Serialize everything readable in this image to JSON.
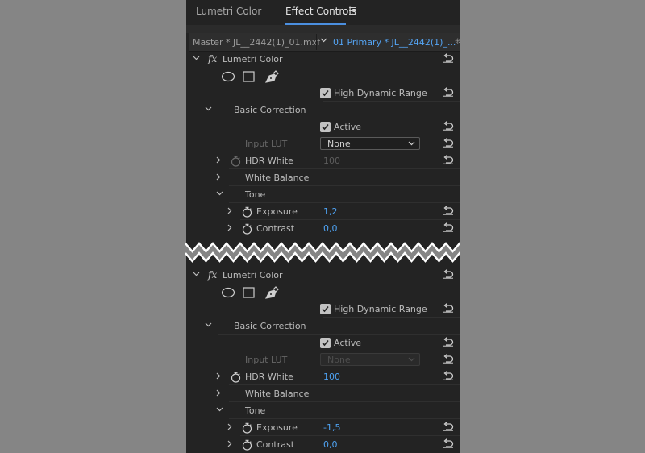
{
  "tabs": [
    {
      "label": "Lumetri Color",
      "active": false
    },
    {
      "label": "Effect Controls",
      "active": true
    }
  ],
  "clip_header": {
    "master_label": "Master * JL__2442(1)_01.mxf",
    "sequence_label": "01 Primary * JL__2442(1)_...",
    "scroll_glyph": "⁜"
  },
  "colors": {
    "panel_bg": "#232323",
    "accent_blue": "#4ea2f2",
    "text": "#bcbcbc",
    "dim_text": "#666666"
  },
  "top": {
    "effect_name": "Lumetri Color",
    "fx_glyph": "fx",
    "hdr_label": "High Dynamic Range",
    "hdr_checked": true,
    "basic_correction_label": "Basic Correction",
    "active_label": "Active",
    "active_checked": true,
    "input_lut_label": "Input LUT",
    "input_lut_value": "None",
    "input_lut_enabled": true,
    "hdr_white_label": "HDR White",
    "hdr_white_value": "100",
    "hdr_white_enabled": false,
    "white_balance_label": "White Balance",
    "tone_label": "Tone",
    "exposure_label": "Exposure",
    "exposure_value": "1,2",
    "contrast_label": "Contrast",
    "contrast_value": "0,0"
  },
  "bottom": {
    "effect_name": "Lumetri Color",
    "fx_glyph": "fx",
    "hdr_label": "High Dynamic Range",
    "hdr_checked": true,
    "basic_correction_label": "Basic Correction",
    "active_label": "Active",
    "active_checked": true,
    "input_lut_label": "Input LUT",
    "input_lut_value": "None",
    "input_lut_enabled": false,
    "hdr_white_label": "HDR White",
    "hdr_white_value": "100",
    "hdr_white_enabled": true,
    "white_balance_label": "White Balance",
    "tone_label": "Tone",
    "exposure_label": "Exposure",
    "exposure_value": "-1,5",
    "contrast_label": "Contrast",
    "contrast_value": "0,0"
  }
}
